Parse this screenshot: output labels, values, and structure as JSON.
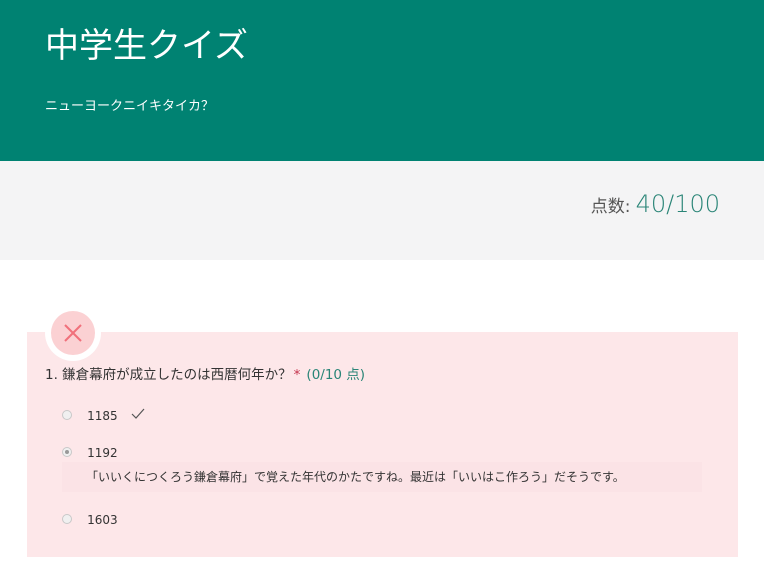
{
  "header": {
    "title": "中学生クイズ",
    "subtitle": "ニューヨークニイキタイカ？",
    "background_color": "#008272"
  },
  "score": {
    "label": "点数:",
    "value": "40/100"
  },
  "question": {
    "text": "1. 鎌倉幕府が成立したのは西暦何年か？",
    "required_mark": "*",
    "points": "(0/10 点)",
    "result": "incorrect",
    "result_icon": "close-icon",
    "options": [
      {
        "label": "1185",
        "selected": false,
        "correct": true,
        "icon": "check-icon"
      },
      {
        "label": "1192",
        "selected": true,
        "correct": false
      },
      {
        "label": "1603",
        "selected": false,
        "correct": false
      }
    ],
    "feedback": "「いいくにつくろう鎌倉幕府」で覚えた年代のかたですね。最近は「いいはこ作ろう」だそうです。"
  },
  "colors": {
    "accent": "#2a8577",
    "incorrect_bg": "#fde7e9",
    "required": "#c4314b"
  }
}
